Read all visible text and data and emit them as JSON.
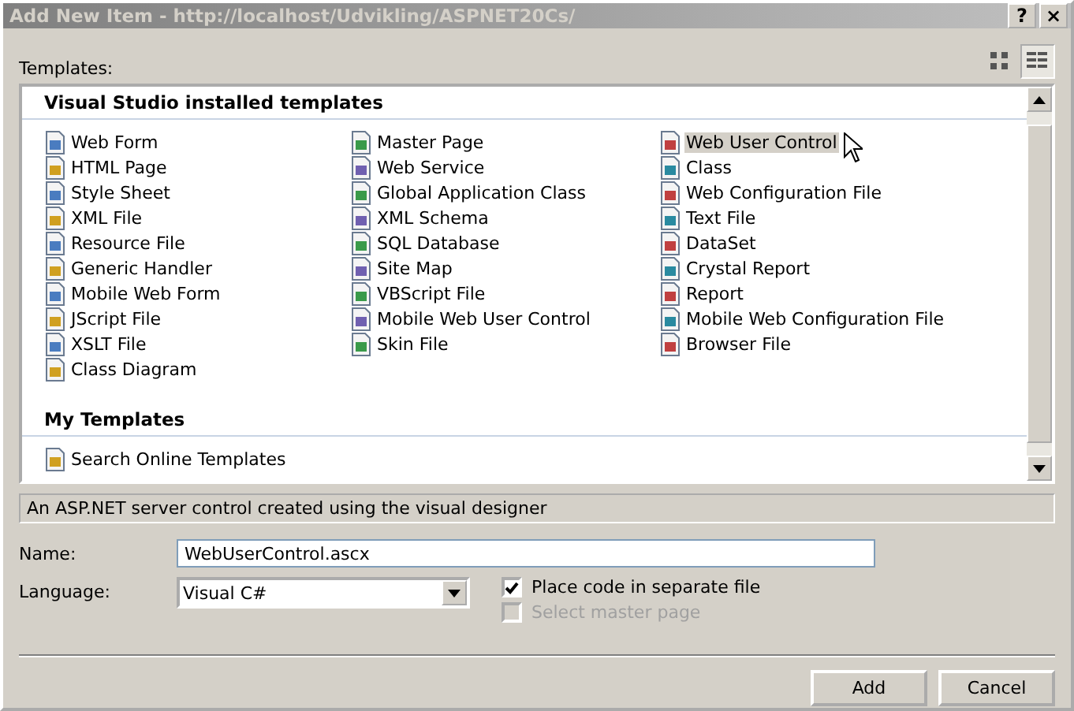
{
  "window": {
    "title": "Add New Item - http://localhost/Udvikling/ASPNET20Cs/",
    "title_buttons": [
      "?",
      "×"
    ]
  },
  "view_buttons": [
    {
      "kind": "large",
      "selected": false
    },
    {
      "kind": "small",
      "selected": true
    }
  ],
  "templates": {
    "label": "Templates:",
    "groups": [
      {
        "title": "Visual Studio installed templates",
        "items": [
          {
            "label": "Web Form",
            "selected": false
          },
          {
            "label": "Master Page",
            "selected": false
          },
          {
            "label": "Web User Control",
            "selected": true
          },
          {
            "label": "HTML Page",
            "selected": false
          },
          {
            "label": "Web Service",
            "selected": false
          },
          {
            "label": "Class",
            "selected": false
          },
          {
            "label": "Style Sheet",
            "selected": false
          },
          {
            "label": "Global Application Class",
            "selected": false
          },
          {
            "label": "Web Configuration File",
            "selected": false
          },
          {
            "label": "XML File",
            "selected": false
          },
          {
            "label": "XML Schema",
            "selected": false
          },
          {
            "label": "Text File",
            "selected": false
          },
          {
            "label": "Resource File",
            "selected": false
          },
          {
            "label": "SQL Database",
            "selected": false
          },
          {
            "label": "DataSet",
            "selected": false
          },
          {
            "label": "Generic Handler",
            "selected": false
          },
          {
            "label": "Site Map",
            "selected": false
          },
          {
            "label": "Crystal Report",
            "selected": false
          },
          {
            "label": "Mobile Web Form",
            "selected": false
          },
          {
            "label": "VBScript File",
            "selected": false
          },
          {
            "label": "Report",
            "selected": false
          },
          {
            "label": "JScript File",
            "selected": false
          },
          {
            "label": "Mobile Web User Control",
            "selected": false
          },
          {
            "label": "Mobile Web Configuration File",
            "selected": false
          },
          {
            "label": "XSLT File",
            "selected": false
          },
          {
            "label": "Skin File",
            "selected": false
          },
          {
            "label": "Browser File",
            "selected": false
          },
          {
            "label": "Class Diagram",
            "selected": false
          }
        ]
      },
      {
        "title": "My Templates",
        "items": [
          {
            "label": "Search Online Templates",
            "selected": false
          }
        ]
      }
    ]
  },
  "description": "An ASP.NET server control created using the visual designer",
  "name": {
    "label": "Name:",
    "value": "WebUserControl.ascx"
  },
  "language": {
    "label": "Language:",
    "value": "Visual C#"
  },
  "options": [
    {
      "label": "Place code in separate file",
      "checked": true,
      "disabled": false
    },
    {
      "label": "Select master page",
      "checked": false,
      "disabled": true
    }
  ],
  "buttons": [
    "Add",
    "Cancel"
  ]
}
